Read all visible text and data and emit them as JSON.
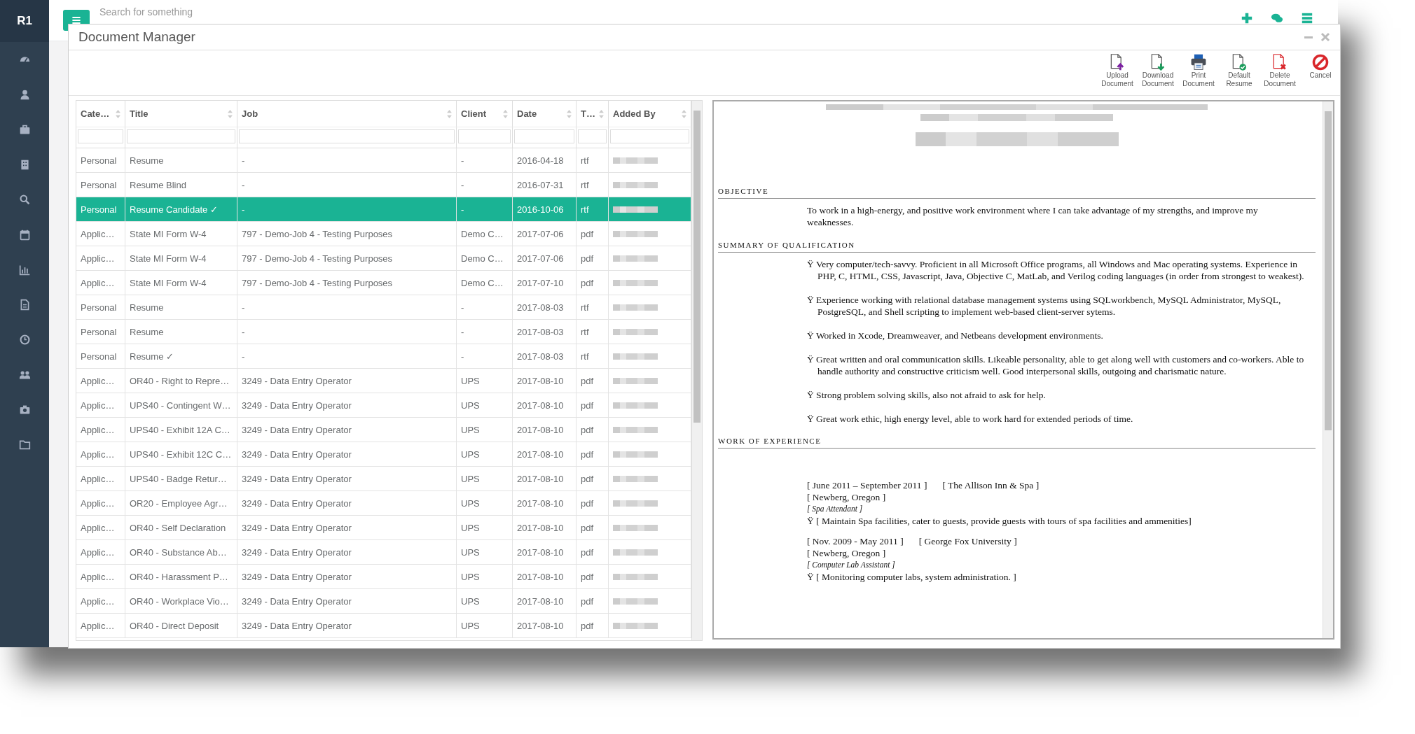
{
  "sidebar": {
    "logo": "R1",
    "items": [
      {
        "kind": "gauge"
      },
      {
        "kind": "person"
      },
      {
        "kind": "briefcase"
      },
      {
        "kind": "building"
      },
      {
        "kind": "search"
      },
      {
        "kind": "calendar"
      },
      {
        "kind": "chart"
      },
      {
        "kind": "document"
      },
      {
        "kind": "clock"
      },
      {
        "kind": "group"
      },
      {
        "kind": "camera"
      },
      {
        "kind": "folder"
      }
    ]
  },
  "top_bar": {
    "search": {
      "placeholder": "Search for something"
    },
    "actions": [
      {
        "kind": "plus"
      },
      {
        "kind": "chat"
      },
      {
        "kind": "server"
      }
    ]
  },
  "dialog": {
    "title": "Document Manager",
    "toolbar": [
      {
        "kind": "upload",
        "label": "Upload Document"
      },
      {
        "kind": "download",
        "label": "Download Document"
      },
      {
        "kind": "print",
        "label": "Print Document"
      },
      {
        "kind": "default",
        "label": "Default Resume"
      },
      {
        "kind": "delete",
        "label": "Delete Document"
      },
      {
        "kind": "cancel",
        "label": "Cancel"
      }
    ],
    "table": {
      "columns": [
        "Cate…",
        "Title",
        "Job",
        "Client",
        "Date",
        "T…",
        "Added By"
      ],
      "rows": [
        {
          "selected": false,
          "cells": [
            "Personal",
            "Resume",
            "-",
            "-",
            "2016-04-18",
            "rtf"
          ]
        },
        {
          "selected": false,
          "cells": [
            "Personal",
            "Resume Blind",
            "-",
            "-",
            "2016-07-31",
            "rtf"
          ]
        },
        {
          "selected": true,
          "cells": [
            "Personal",
            "Resume Candidate ✓",
            "-",
            "-",
            "2016-10-06",
            "rtf"
          ]
        },
        {
          "selected": false,
          "cells": [
            "Applic…",
            "State MI Form W-4",
            "797 - Demo-Job 4 - Testing Purposes",
            "Demo C…",
            "2017-07-06",
            "pdf"
          ]
        },
        {
          "selected": false,
          "cells": [
            "Applic…",
            "State MI Form W-4",
            "797 - Demo-Job 4 - Testing Purposes",
            "Demo C…",
            "2017-07-06",
            "pdf"
          ]
        },
        {
          "selected": false,
          "cells": [
            "Applic…",
            "State MI Form W-4",
            "797 - Demo-Job 4 - Testing Purposes",
            "Demo C…",
            "2017-07-10",
            "pdf"
          ]
        },
        {
          "selected": false,
          "cells": [
            "Personal",
            "Resume",
            "-",
            "-",
            "2017-08-03",
            "rtf"
          ]
        },
        {
          "selected": false,
          "cells": [
            "Personal",
            "Resume",
            "-",
            "-",
            "2017-08-03",
            "rtf"
          ]
        },
        {
          "selected": false,
          "cells": [
            "Personal",
            "Resume ✓",
            "-",
            "-",
            "2017-08-03",
            "rtf"
          ]
        },
        {
          "selected": false,
          "cells": [
            "Applic…",
            "OR40 - Right to Repre…",
            "3249 - Data Entry Operator",
            "UPS",
            "2017-08-10",
            "pdf"
          ]
        },
        {
          "selected": false,
          "cells": [
            "Applic…",
            "UPS40 - Contingent W…",
            "3249 - Data Entry Operator",
            "UPS",
            "2017-08-10",
            "pdf"
          ]
        },
        {
          "selected": false,
          "cells": [
            "Applic…",
            "UPS40 - Exhibit 12A C…",
            "3249 - Data Entry Operator",
            "UPS",
            "2017-08-10",
            "pdf"
          ]
        },
        {
          "selected": false,
          "cells": [
            "Applic…",
            "UPS40 - Exhibit 12C C…",
            "3249 - Data Entry Operator",
            "UPS",
            "2017-08-10",
            "pdf"
          ]
        },
        {
          "selected": false,
          "cells": [
            "Applic…",
            "UPS40 - Badge Retur…",
            "3249 - Data Entry Operator",
            "UPS",
            "2017-08-10",
            "pdf"
          ]
        },
        {
          "selected": false,
          "cells": [
            "Applic…",
            "OR20 - Employee Agr…",
            "3249 - Data Entry Operator",
            "UPS",
            "2017-08-10",
            "pdf"
          ]
        },
        {
          "selected": false,
          "cells": [
            "Applic…",
            "OR40 - Self Declaration",
            "3249 - Data Entry Operator",
            "UPS",
            "2017-08-10",
            "pdf"
          ]
        },
        {
          "selected": false,
          "cells": [
            "Applic…",
            "OR40 - Substance Ab…",
            "3249 - Data Entry Operator",
            "UPS",
            "2017-08-10",
            "pdf"
          ]
        },
        {
          "selected": false,
          "cells": [
            "Applic…",
            "OR40 - Harassment P…",
            "3249 - Data Entry Operator",
            "UPS",
            "2017-08-10",
            "pdf"
          ]
        },
        {
          "selected": false,
          "cells": [
            "Applic…",
            "OR40 - Workplace Vio…",
            "3249 - Data Entry Operator",
            "UPS",
            "2017-08-10",
            "pdf"
          ]
        },
        {
          "selected": false,
          "cells": [
            "Applic…",
            "OR40 - Direct Deposit",
            "3249 - Data Entry Operator",
            "UPS",
            "2017-08-10",
            "pdf"
          ]
        }
      ]
    },
    "preview": {
      "sections": [
        {
          "heading": "OBJECTIVE",
          "lines": [
            {
              "kind": "para",
              "text": "To work in a high-energy, and positive work environment where I can take advantage of my strengths, and improve my weaknesses."
            }
          ]
        },
        {
          "heading": "SUMMARY OF QUALIFICATION",
          "lines": [
            {
              "kind": "bullet",
              "text": "Ÿ Very computer/tech-savvy.  Proficient in all Microsoft Office programs, all Windows and Mac operating systems. Experience in PHP, C, HTML, CSS, Javascript, Java, Objective C, MatLab, and Verilog coding languages (in order from strongest to weakest)."
            },
            {
              "kind": "bullet",
              "text": "Ÿ Experience working with relational database management systems using SQLworkbench, MySQL Administrator, MySQL, PostgreSQL, and Shell scripting to implement web-based client-server sytems."
            },
            {
              "kind": "bullet",
              "text": "Ÿ Worked in Xcode, Dreamweaver, and Netbeans development environments."
            },
            {
              "kind": "bullet",
              "text": "Ÿ Great written and oral communication skills. Likeable personality, able to get along well with customers and co-workers. Able to handle authority and constructive criticism well. Good interpersonal skills, outgoing and charismatic nature."
            },
            {
              "kind": "bullet",
              "text": "Ÿ Strong problem solving skills, also not afraid to ask for help."
            },
            {
              "kind": "bullet",
              "text": "Ÿ Great work ethic, high energy level, able to work hard for extended periods of time."
            }
          ]
        },
        {
          "heading": "WORK OF EXPERIENCE",
          "lines": [
            {
              "kind": "pair",
              "left": "[  June 2011 –  September 2011 ]",
              "right": "[  The Allison Inn & Spa ]"
            },
            {
              "kind": "plain",
              "text": "[ Newberg, Oregon ]"
            },
            {
              "kind": "role",
              "text": "[ Spa Attendant ]"
            },
            {
              "kind": "plain",
              "text": "Ÿ   [ Maintain Spa facilities, cater to guests, provide guests with tours of spa facilities and ammenities]"
            },
            {
              "kind": "pair",
              "left": "[  Nov. 2009 - May 2011 ]",
              "right": "[  George Fox University ]"
            },
            {
              "kind": "plain",
              "text": "[ Newberg, Oregon ]"
            },
            {
              "kind": "role",
              "text": "[ Computer Lab Assistant ]"
            },
            {
              "kind": "plain",
              "text": "Ÿ   [ Monitoring computer labs, system administration. ]"
            }
          ]
        }
      ]
    }
  }
}
